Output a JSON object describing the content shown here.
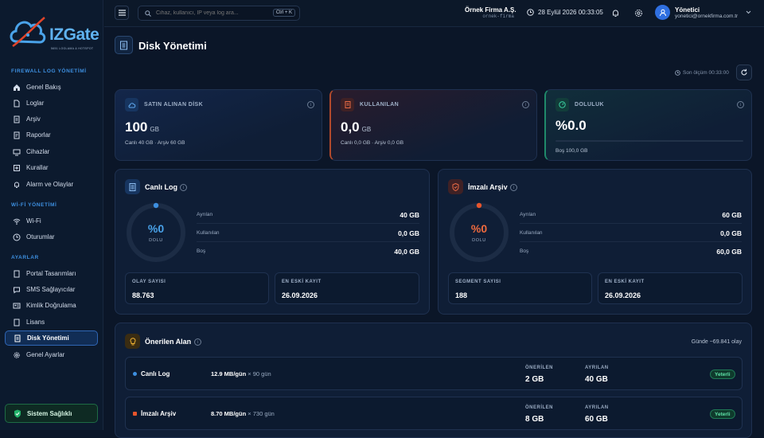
{
  "app": {
    "logo_text": "IZGate",
    "logo_sub": "5651 LOGLAMA & HOTSPOT"
  },
  "sidebar": {
    "sections": [
      {
        "title": "FIREWALL LOG YÖNETİMİ"
      },
      {
        "title": "Wİ-Fİ YÖNETİMİ"
      },
      {
        "title": "AYARLAR"
      }
    ],
    "items": [
      {
        "label": "Genel Bakış",
        "icon": "home-icon"
      },
      {
        "label": "Loglar",
        "icon": "file-icon"
      },
      {
        "label": "Arşiv",
        "icon": "archive-icon"
      },
      {
        "label": "Raporlar",
        "icon": "report-icon"
      },
      {
        "label": "Cihazlar",
        "icon": "monitor-icon"
      },
      {
        "label": "Kurallar",
        "icon": "rules-icon"
      },
      {
        "label": "Alarm ve Olaylar",
        "icon": "bell-icon"
      },
      {
        "label": "Wi-Fi",
        "icon": "wifi-icon"
      },
      {
        "label": "Oturumlar",
        "icon": "clock-icon"
      },
      {
        "label": "Portal Tasarımları",
        "icon": "portal-icon"
      },
      {
        "label": "SMS Sağlayıcılar",
        "icon": "sms-icon"
      },
      {
        "label": "Kimlik Doğrulama",
        "icon": "id-card-icon"
      },
      {
        "label": "Lisans",
        "icon": "license-icon"
      },
      {
        "label": "Disk Yönetimi",
        "icon": "disk-icon",
        "active": true
      },
      {
        "label": "Genel Ayarlar",
        "icon": "gear-icon"
      }
    ],
    "health_label": "Sistem Sağlıklı"
  },
  "topbar": {
    "search_placeholder": "Cihaz, kullanıcı, IP veya log ara...",
    "shortcut": "Ctrl + K",
    "company_name": "Örnek Firma A.Ş.",
    "company_slug": "ornek-firma",
    "datetime": "28 Eylül 2026 00:33:05",
    "user_name": "Yönetici",
    "user_email": "yonetici@ornekfirma.com.tr"
  },
  "page": {
    "title": "Disk Yönetimi",
    "last_measure": "Son ölçüm 00:33:00"
  },
  "stats": [
    {
      "title": "SATIN ALINAN DİSK",
      "value": "100",
      "unit": "GB",
      "sub": "Canlı 40 GB · Arşiv 60 GB",
      "color": "#3d8fe0"
    },
    {
      "title": "KULLANILAN",
      "value": "0,0",
      "unit": "GB",
      "sub": "Canlı 0,0 GB · Arşiv 0,0 GB",
      "color": "#e0663d"
    },
    {
      "title": "DOLULUK",
      "value": "%0.0",
      "unit": "",
      "sub": "Boş 100,0 GB",
      "color": "#3ad0a0",
      "fill": 0.0
    }
  ],
  "live_log": {
    "title": "Canlı Log",
    "pct": "%0",
    "pct_label": "DOLU",
    "fill": 0.0,
    "rows": [
      {
        "label": "Ayrılan",
        "value": "40 GB"
      },
      {
        "label": "Kullanılan",
        "value": "0,0 GB"
      },
      {
        "label": "Boş",
        "value": "40,0 GB"
      }
    ],
    "mini": [
      {
        "label": "OLAY SAYISI",
        "value": "88.763"
      },
      {
        "label": "EN ESKİ KAYIT",
        "value": "26.09.2026"
      }
    ]
  },
  "signed_archive": {
    "title": "İmzalı Arşiv",
    "pct": "%0",
    "pct_label": "DOLU",
    "fill": 0.0,
    "rows": [
      {
        "label": "Ayrılan",
        "value": "60 GB"
      },
      {
        "label": "Kullanılan",
        "value": "0,0 GB"
      },
      {
        "label": "Boş",
        "value": "60,0 GB"
      }
    ],
    "mini": [
      {
        "label": "SEGMENT SAYISI",
        "value": "188"
      },
      {
        "label": "EN ESKİ KAYIT",
        "value": "26.09.2026"
      }
    ]
  },
  "recommended": {
    "title": "Önerilen Alan",
    "daily": "Günde ~69.841 olay",
    "col_recommended": "ÖNERİLEN",
    "col_allocated": "AYRILAN",
    "rows": [
      {
        "name": "Canlı Log",
        "rate": "12.9 MB/gün",
        "days": "× 90 gün",
        "recommended": "2 GB",
        "allocated": "40 GB",
        "status": "Yeterli",
        "color": "#3d8fe0"
      },
      {
        "name": "İmzalı Arşiv",
        "rate": "8.70 MB/gün",
        "days": "× 730 gün",
        "recommended": "8 GB",
        "allocated": "60 GB",
        "status": "Yeterli",
        "color": "#e0663d"
      }
    ]
  }
}
